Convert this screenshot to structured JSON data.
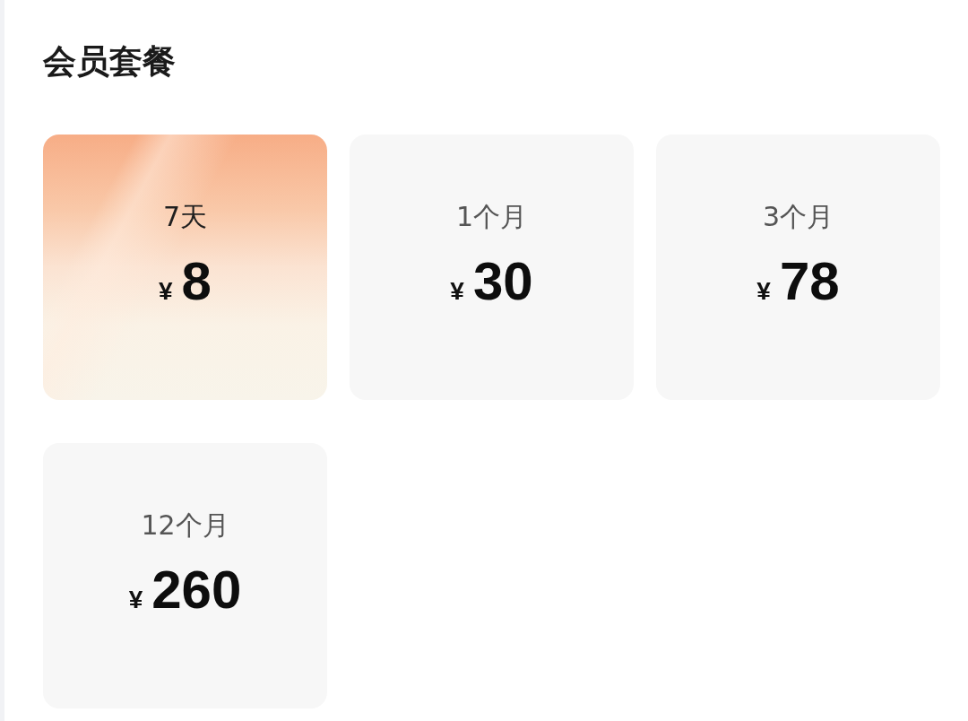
{
  "title": "会员套餐",
  "plans": [
    {
      "label": "7天",
      "currency": "¥",
      "price": "8",
      "selected": true
    },
    {
      "label": "1个月",
      "currency": "¥",
      "price": "30",
      "selected": false
    },
    {
      "label": "3个月",
      "currency": "¥",
      "price": "78",
      "selected": false
    },
    {
      "label": "12个月",
      "currency": "¥",
      "price": "260",
      "selected": false
    }
  ]
}
